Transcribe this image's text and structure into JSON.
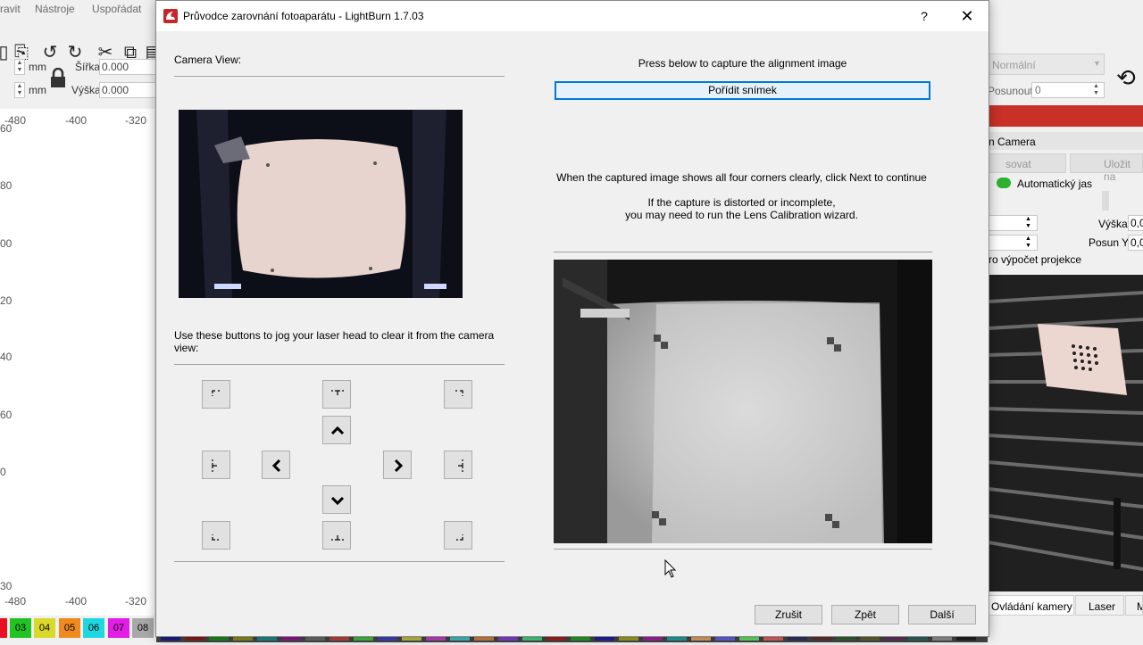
{
  "background": {
    "menu": [
      "ravit",
      "Nástroje",
      "Uspořádat"
    ],
    "numeric": {
      "unit1": "mm",
      "unit2": "mm",
      "width_label": "Šířka",
      "width_value": "0.000",
      "height_label": "Výška",
      "height_value": "0.000"
    },
    "ruler_x_top": [
      "-480",
      "-400",
      "-320"
    ],
    "ruler_x_bottom": [
      "-480",
      "-400",
      "-320"
    ],
    "ruler_y": [
      "60",
      "80",
      "00",
      "20",
      "40",
      "60",
      "0",
      "30"
    ],
    "palette": [
      "03",
      "04",
      "05",
      "06",
      "07",
      "08"
    ],
    "right_panel": {
      "mode_select": "Normální",
      "shift_label": "Posunout",
      "shift_value": "0",
      "camera_header": "n Camera",
      "btn_left": "sovat",
      "btn_right": "Uložit na",
      "auto_brightness": "Automatický jas",
      "height_label": "Výška",
      "height_value": "0,0",
      "shift_y_label": "Posun Y",
      "shift_y_value": "0,0",
      "projection_text": "ro výpočet projekce",
      "tabs": [
        "Ovládání kamery",
        "Laser",
        "M"
      ]
    }
  },
  "dialog": {
    "title": "Průvodce zarovnání fotoaparátu - LightBurn 1.7.03",
    "help": "?",
    "close": "✕",
    "camera_view_label": "Camera View:",
    "jog_instructions": "Use these buttons to jog your laser head to clear it from the camera view:",
    "capture_prompt": "Press below to capture the alignment image",
    "capture_button": "Pořídit snímek",
    "next_hint": "When the captured image shows all four corners clearly, click Next to continue",
    "distort_hint_1": "If the capture is distorted or incomplete,",
    "distort_hint_2": "you may need to run the Lens Calibration wizard.",
    "buttons": {
      "cancel": "Zrušit",
      "back": "Zpět",
      "next": "Další"
    }
  }
}
